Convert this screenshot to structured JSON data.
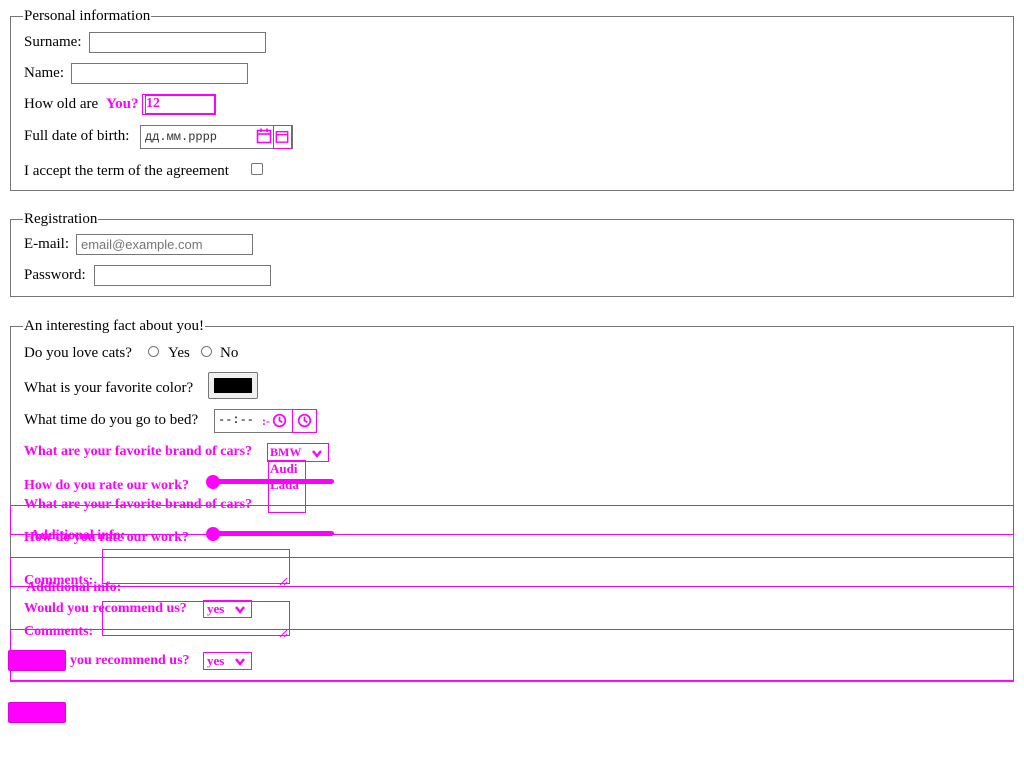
{
  "personal": {
    "legend": "Personal information",
    "surname_label": "Surname:",
    "name_label": "Name:",
    "age_label": "How old are",
    "age_label_overlay": "You?",
    "age_value": "12",
    "dob_label": "Full date of birth:",
    "dob_placeholder": "дд.мм.рррр",
    "agreement_label": "I accept the term of the agreement"
  },
  "registration": {
    "legend": "Registration",
    "email_label": "E-mail:",
    "email_placeholder": "email@example.com",
    "password_label": "Password:"
  },
  "interesting": {
    "legend": "An interesting fact about you!",
    "cats_label": "Do you love cats?",
    "cats_yes": "Yes",
    "cats_no": "No",
    "color_label": "What is your favorite color?",
    "color_value": "#000000",
    "bedtime_label": "What time do you go to bed?",
    "bedtime_value": "--:--",
    "cars_label": "What are your favorite brand of cars?",
    "cars_selected": "BMW",
    "cars_options": [
      "Audi",
      "Lada"
    ],
    "rate_label": "How do you rate our work?",
    "cars_label_dup": "What are your favorite brand of cars?",
    "rate_label_dup": "How do you rate our work?",
    "additional_overlay": "Additional info:",
    "comments_label": "Comments:",
    "additional_label": "Additional info:",
    "recommend_label": "Would you recommend us?",
    "recommend_value": "yes",
    "comments_label_dup": "Comments:",
    "recommend_label_dup": "you recommend us?",
    "recommend_value_dup": "yes"
  },
  "colors": {
    "overlay": "#ff00ff",
    "border": "#767676"
  },
  "icons": [
    "calendar-icon",
    "clock-icon",
    "chevron-down-icon"
  ]
}
